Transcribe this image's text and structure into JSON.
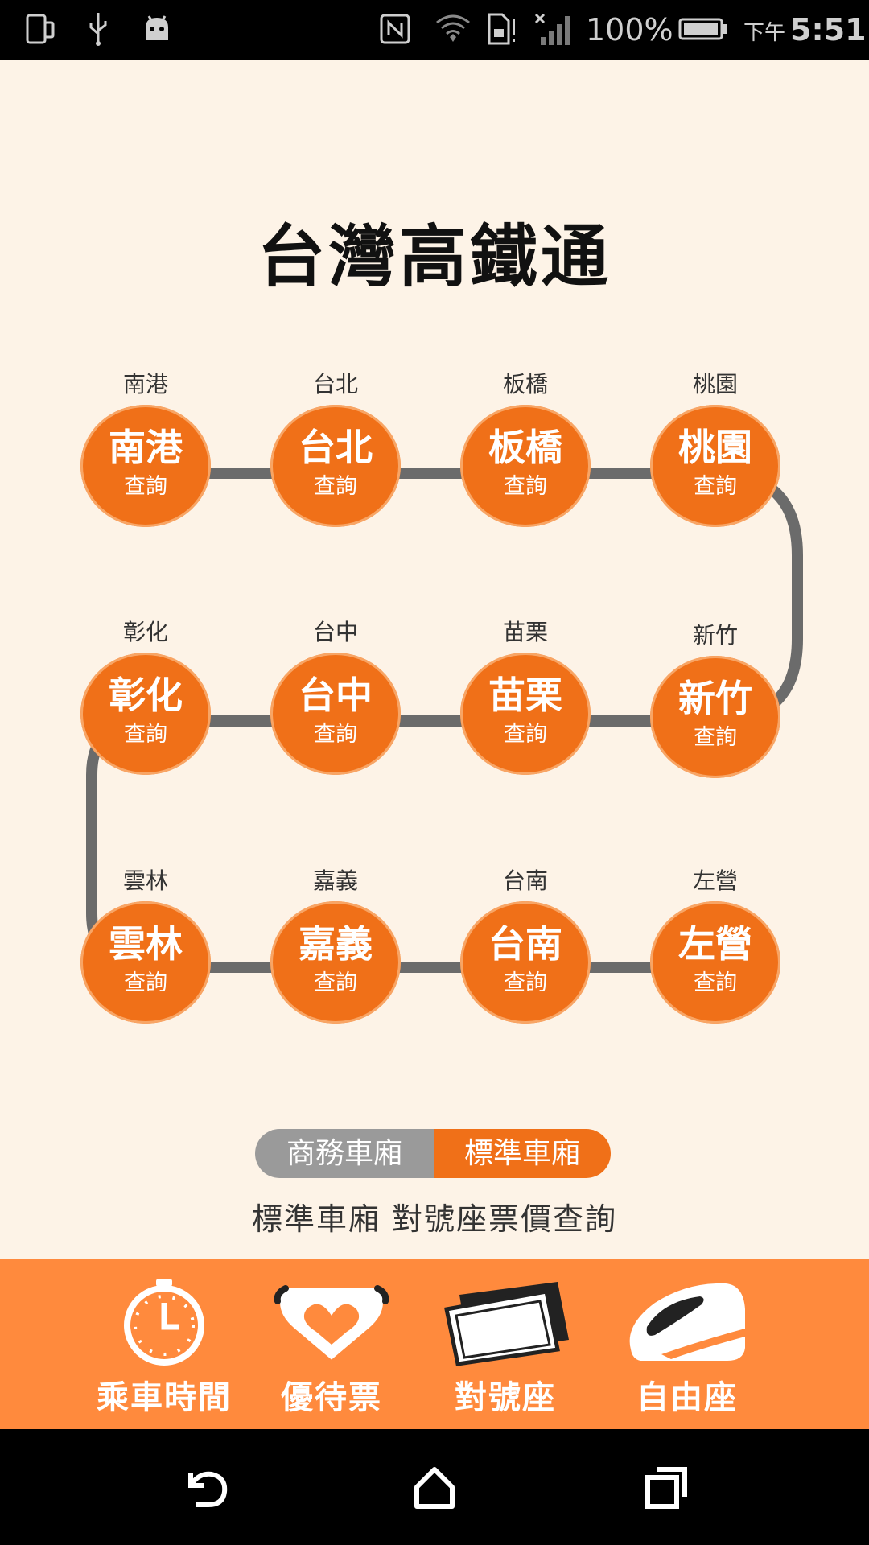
{
  "status_bar": {
    "battery_text": "100%",
    "time_period": "下午",
    "time": "5:51"
  },
  "app": {
    "title": "台灣高鐵通"
  },
  "stations": [
    {
      "label": "南港",
      "name": "南港",
      "action": "查詢"
    },
    {
      "label": "台北",
      "name": "台北",
      "action": "查詢"
    },
    {
      "label": "板橋",
      "name": "板橋",
      "action": "查詢"
    },
    {
      "label": "桃園",
      "name": "桃園",
      "action": "查詢"
    },
    {
      "label": "新竹",
      "name": "新竹",
      "action": "查詢"
    },
    {
      "label": "苗栗",
      "name": "苗栗",
      "action": "查詢"
    },
    {
      "label": "台中",
      "name": "台中",
      "action": "查詢"
    },
    {
      "label": "彰化",
      "name": "彰化",
      "action": "查詢"
    },
    {
      "label": "雲林",
      "name": "雲林",
      "action": "查詢"
    },
    {
      "label": "嘉義",
      "name": "嘉義",
      "action": "查詢"
    },
    {
      "label": "台南",
      "name": "台南",
      "action": "查詢"
    },
    {
      "label": "左營",
      "name": "左營",
      "action": "查詢"
    }
  ],
  "car_class_toggle": {
    "business_label": "商務車廂",
    "standard_label": "標準車廂",
    "selected": "標準車廂"
  },
  "fare_caption": "標準車廂 對號座票價查詢",
  "bottom_nav": [
    {
      "label": "乘車時間",
      "icon": "clock-icon"
    },
    {
      "label": "優待票",
      "icon": "heart-hands-icon"
    },
    {
      "label": "對號座",
      "icon": "ticket-icon"
    },
    {
      "label": "自由座",
      "icon": "bullet-train-icon"
    }
  ],
  "colors": {
    "accent": "#f07018",
    "bottom_bar": "#ff8a3d",
    "track": "#6b6b6b",
    "background": "#fdf3e7",
    "inactive_toggle": "#9a9a9a"
  },
  "system_nav": {
    "back": "back-icon",
    "home": "home-icon",
    "recents": "recents-icon"
  }
}
